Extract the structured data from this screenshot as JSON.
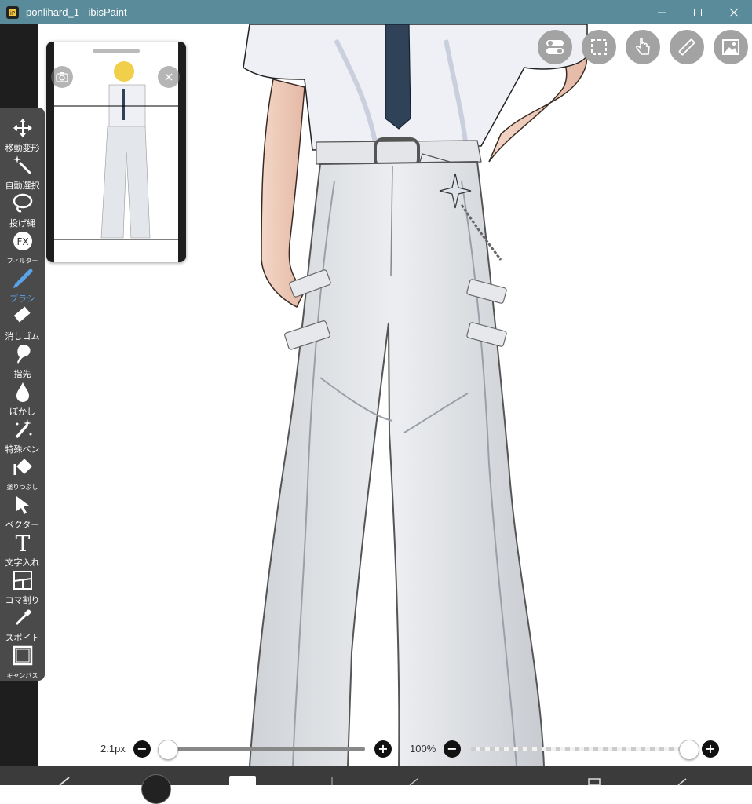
{
  "window": {
    "title": "ponlihard_1 - ibisPaint",
    "minimize_glyph": "—",
    "maximize_glyph": "☐",
    "close_glyph": "✕"
  },
  "tools": [
    {
      "name": "move-transform",
      "label": "移動変形",
      "icon": "move-icon"
    },
    {
      "name": "auto-select",
      "label": "自動選択",
      "icon": "magic-wand-icon"
    },
    {
      "name": "lasso",
      "label": "投げ縄",
      "icon": "lasso-icon"
    },
    {
      "name": "filter",
      "label": "フィルター",
      "icon": "fx-icon"
    },
    {
      "name": "brush",
      "label": "ブラシ",
      "icon": "brush-icon",
      "active": true
    },
    {
      "name": "eraser",
      "label": "消しゴム",
      "icon": "eraser-icon"
    },
    {
      "name": "smudge",
      "label": "指先",
      "icon": "finger-icon"
    },
    {
      "name": "blur",
      "label": "ぼかし",
      "icon": "drop-icon"
    },
    {
      "name": "special-pen",
      "label": "特殊ペン",
      "icon": "sparkle-pen-icon"
    },
    {
      "name": "fill",
      "label": "塗りつぶし",
      "icon": "bucket-icon"
    },
    {
      "name": "vector",
      "label": "ベクター",
      "icon": "arrow-cursor-icon"
    },
    {
      "name": "text",
      "label": "文字入れ",
      "icon": "text-icon"
    },
    {
      "name": "frame-divider",
      "label": "コマ割り",
      "icon": "panel-icon"
    },
    {
      "name": "eyedropper",
      "label": "スポイト",
      "icon": "eyedropper-icon"
    },
    {
      "name": "canvas",
      "label": "キャンバス",
      "icon": "canvas-icon"
    }
  ],
  "brush": {
    "size_label": "2.1px",
    "size_value": 2.1,
    "opacity_label": "100%",
    "opacity_value": 1.0
  },
  "colors": {
    "titlebar": "#5a8b9a",
    "toolbar": "#4a4a4a",
    "active_tool": "#5aa3e8",
    "tie": "#2f4258"
  }
}
